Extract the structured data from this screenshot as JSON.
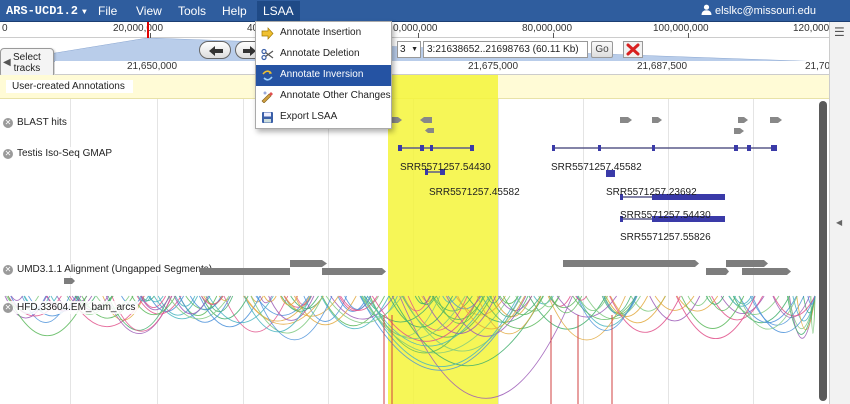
{
  "menubar": {
    "app_title": "ARS-UCD1.2",
    "menus": [
      "File",
      "View",
      "Tools",
      "Help",
      "LSAA"
    ],
    "user_email": "elslkc@missouri.edu"
  },
  "overview_ruler": {
    "labels": [
      "0",
      "20,000,000",
      "40",
      "0,000,000",
      "80,000,000",
      "100,000,000",
      "120,000"
    ]
  },
  "nav": {
    "chrom_value": "3",
    "location": "3:21638652..21698763 (60.11 Kb)",
    "go_label": "Go"
  },
  "select_tracks": {
    "label_line1": "Select",
    "label_line2": "tracks"
  },
  "detail_ruler": {
    "labels": [
      "21,650,000",
      "21,675,000",
      "21,687,500",
      "21,70"
    ]
  },
  "tracks": {
    "annotations": "User-created Annotations",
    "blast": "BLAST hits",
    "isoseq": "Testis Iso-Seq GMAP",
    "umd": "UMD3.1.1 Alignment (Ungapped Segments)",
    "hfd": "HFD.33604.EM_bam_arcs"
  },
  "isoseq_features": [
    "SRR5571257.54430",
    "SRR5571257.45582",
    "SRR5571257.45582",
    "SRR5571257.23692",
    "SRR5571257.54430",
    "SRR5571257.55826"
  ],
  "lsaa_menu": {
    "items": [
      {
        "label": "Annotate Insertion",
        "icon": "insertion-icon"
      },
      {
        "label": "Annotate Deletion",
        "icon": "scissors-icon"
      },
      {
        "label": "Annotate Inversion",
        "icon": "inversion-icon"
      },
      {
        "label": "Annotate Other Changes",
        "icon": "other-changes-icon"
      },
      {
        "label": "Export LSAA",
        "icon": "floppy-disk-icon"
      }
    ],
    "active_item": "Annotate Inversion"
  },
  "colors": {
    "menubar": "#2f5d9e",
    "highlight": "#f4f43a",
    "feature_blue": "#3a3aa8",
    "feature_gray": "#8a8a8a",
    "menu_active": "#2553a3"
  }
}
